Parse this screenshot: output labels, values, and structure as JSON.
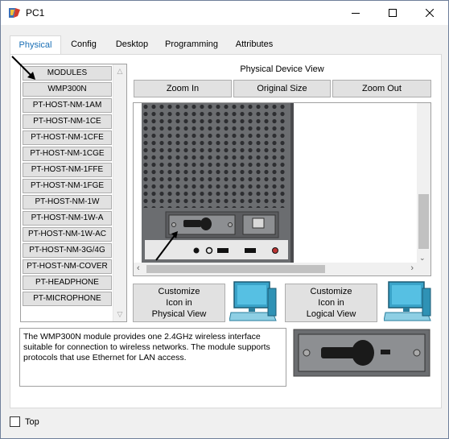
{
  "window": {
    "title": "PC1",
    "minimize_label": "Minimize",
    "maximize_label": "Maximize",
    "close_label": "Close"
  },
  "tabs": [
    {
      "label": "Physical",
      "active": true
    },
    {
      "label": "Config",
      "active": false
    },
    {
      "label": "Desktop",
      "active": false
    },
    {
      "label": "Programming",
      "active": false
    },
    {
      "label": "Attributes",
      "active": false
    }
  ],
  "modules": {
    "items": [
      "MODULES",
      "WMP300N",
      "PT-HOST-NM-1AM",
      "PT-HOST-NM-1CE",
      "PT-HOST-NM-1CFE",
      "PT-HOST-NM-1CGE",
      "PT-HOST-NM-1FFE",
      "PT-HOST-NM-1FGE",
      "PT-HOST-NM-1W",
      "PT-HOST-NM-1W-A",
      "PT-HOST-NM-1W-AC",
      "PT-HOST-NM-3G/4G",
      "PT-HOST-NM-COVER",
      "PT-HEADPHONE",
      "PT-MICROPHONE"
    ]
  },
  "device_view": {
    "title": "Physical Device View",
    "zoom_in": "Zoom In",
    "original_size": "Original Size",
    "zoom_out": "Zoom Out"
  },
  "customize": {
    "physical_label": "Customize\nIcon in\nPhysical View",
    "logical_label": "Customize\nIcon in\nLogical View"
  },
  "description": "The WMP300N module provides one 2.4GHz wireless interface suitable for connection to wireless networks. The module supports protocols that use Ethernet for LAN access.",
  "footer": {
    "top_label": "Top",
    "top_checked": false
  },
  "colors": {
    "accent": "#1f77c9",
    "button_face": "#e1e1e1",
    "panel_gray": "#6b6d70"
  }
}
